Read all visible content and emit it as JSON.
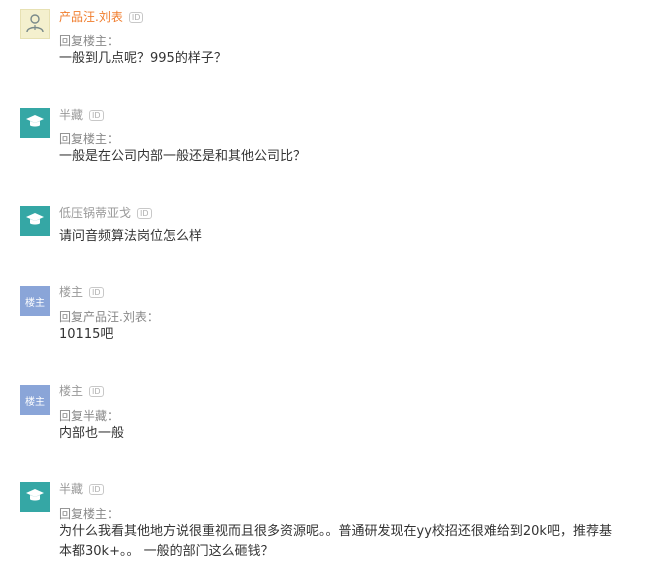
{
  "comments": [
    {
      "username": "产品汪.刘表",
      "badge": "ID",
      "reply_label": "回复楼主：",
      "body": "一般到几点呢？995的样子？",
      "avatar_icon": "user-icon"
    },
    {
      "username": "半藏",
      "badge": "ID",
      "reply_label": "回复楼主：",
      "body": "一般是在公司内部一般还是和其他公司比？",
      "avatar_icon": "graduation-cap-icon"
    },
    {
      "username": "低压锅蒂亚戈",
      "badge": "ID",
      "body": "请问音频算法岗位怎么样",
      "avatar_icon": "graduation-cap-icon"
    },
    {
      "username": "楼主",
      "badge": "ID",
      "avatar_text": "楼主",
      "reply_label": "回复产品汪.刘表：",
      "body": "10115吧"
    },
    {
      "username": "楼主",
      "badge": "ID",
      "avatar_text": "楼主",
      "reply_label": "回复半藏：",
      "body": "内部也一般"
    },
    {
      "username": "半藏",
      "badge": "ID",
      "reply_label": "回复楼主：",
      "body_line1": "为什么我看其他地方说很重视而且很多资源呢。。普通研发现在yy校招还很难给到20k吧，推荐基",
      "body_line2": "本都30k+。。 一般的部门这么砸钱？",
      "avatar_icon": "graduation-cap-icon"
    }
  ],
  "colors": {
    "orange_name": "#f07d2d",
    "teal_avatar": "#35a7a5",
    "blue_avatar": "#8aa5d8",
    "user_avatar_bg": "#f4f0ce"
  }
}
